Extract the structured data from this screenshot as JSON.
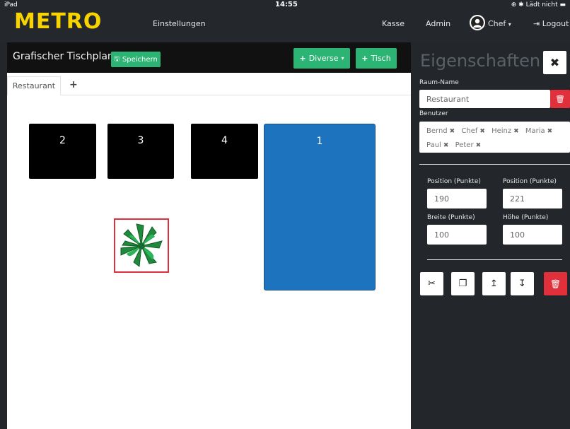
{
  "status": {
    "device": "iPad",
    "time": "14:55",
    "battery": "Lädt nicht"
  },
  "topnav": {
    "logo": "METRO",
    "settings": "Einstellungen",
    "cashier": "Kasse",
    "admin": "Admin",
    "user": "Chef",
    "logout": "Logout"
  },
  "plan": {
    "title": "Grafischer Tischplan",
    "save_label": "Speichern",
    "misc_label": "Diverse",
    "table_label": "Tisch",
    "tab_active": "Restaurant",
    "tab_add": "+",
    "tables": [
      "2",
      "3",
      "4",
      "1"
    ]
  },
  "properties": {
    "title": "Eigenschaften",
    "room_name_label": "Raum-Name",
    "room_name_value": "Restaurant",
    "users_label": "Benutzer",
    "users": [
      "Bernd",
      "Chef",
      "Heinz",
      "Maria",
      "Paul",
      "Peter"
    ],
    "pos_x_label": "Position (Punkte)",
    "pos_x_value": "190",
    "pos_y_label": "Position (Punkte)",
    "pos_y_value": "221",
    "width_label": "Breite (Punkte)",
    "width_value": "100",
    "height_label": "Höhe (Punkte)",
    "height_value": "100"
  },
  "colors": {
    "brand_yellow": "#f7d300",
    "accent_green": "#2bb473",
    "danger_red": "#e0303c",
    "selected_blue": "#1e73be",
    "panel_dark": "#23272b"
  }
}
